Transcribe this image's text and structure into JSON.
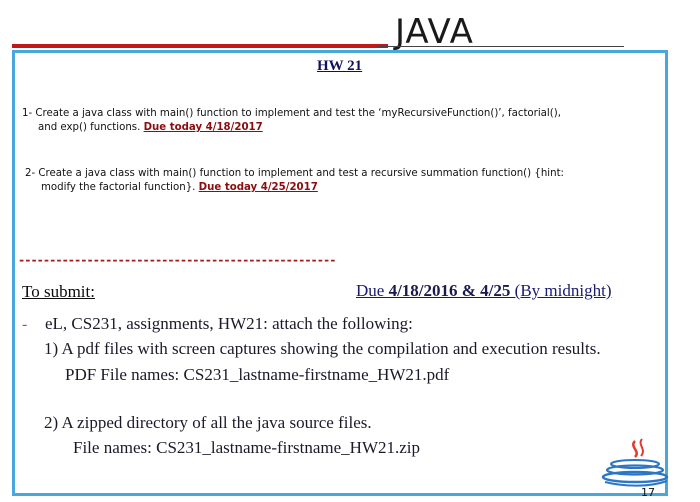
{
  "slide": {
    "title": "JAVA",
    "hw_title": "HW 21",
    "item1": {
      "line1": "1- Create a java class with main() function to implement and test the ‘myRecursiveFunction()’, factorial(),",
      "line2_prefix": "and exp() functions. ",
      "due": "Due  today 4/18/2017"
    },
    "item2": {
      "line1": "2- Create a java class with main() function to implement and test  a recursive summation function()  {hint:",
      "line2_prefix": "modify the factorial function}. ",
      "due": "Due  today 4/25/2017"
    },
    "dashes": "---------------------------------------------------",
    "submission": {
      "heading": "To submit:",
      "due_prefix": "Due  ",
      "due_dates": "4/18/2016  & 4/25",
      "due_suffix": " (By midnight)",
      "bullet": "-",
      "intro": "eL, CS231, assignments, HW21: attach the following:",
      "item1": "1)  A pdf files with screen captures showing the compilation and execution results.",
      "item1_names": "PDF File names: CS231_lastname-firstname_HW21.pdf",
      "item2": "2) A zipped directory of all the java source files.",
      "item2_names": "File names: CS231_lastname-firstname_HW21.zip"
    },
    "page_number": "17",
    "colors": {
      "frame": "#49a7dc",
      "red_bar": "#c21818",
      "due_red": "#8b0d0d"
    },
    "icons": [
      "java-coffee-logo-icon"
    ]
  }
}
